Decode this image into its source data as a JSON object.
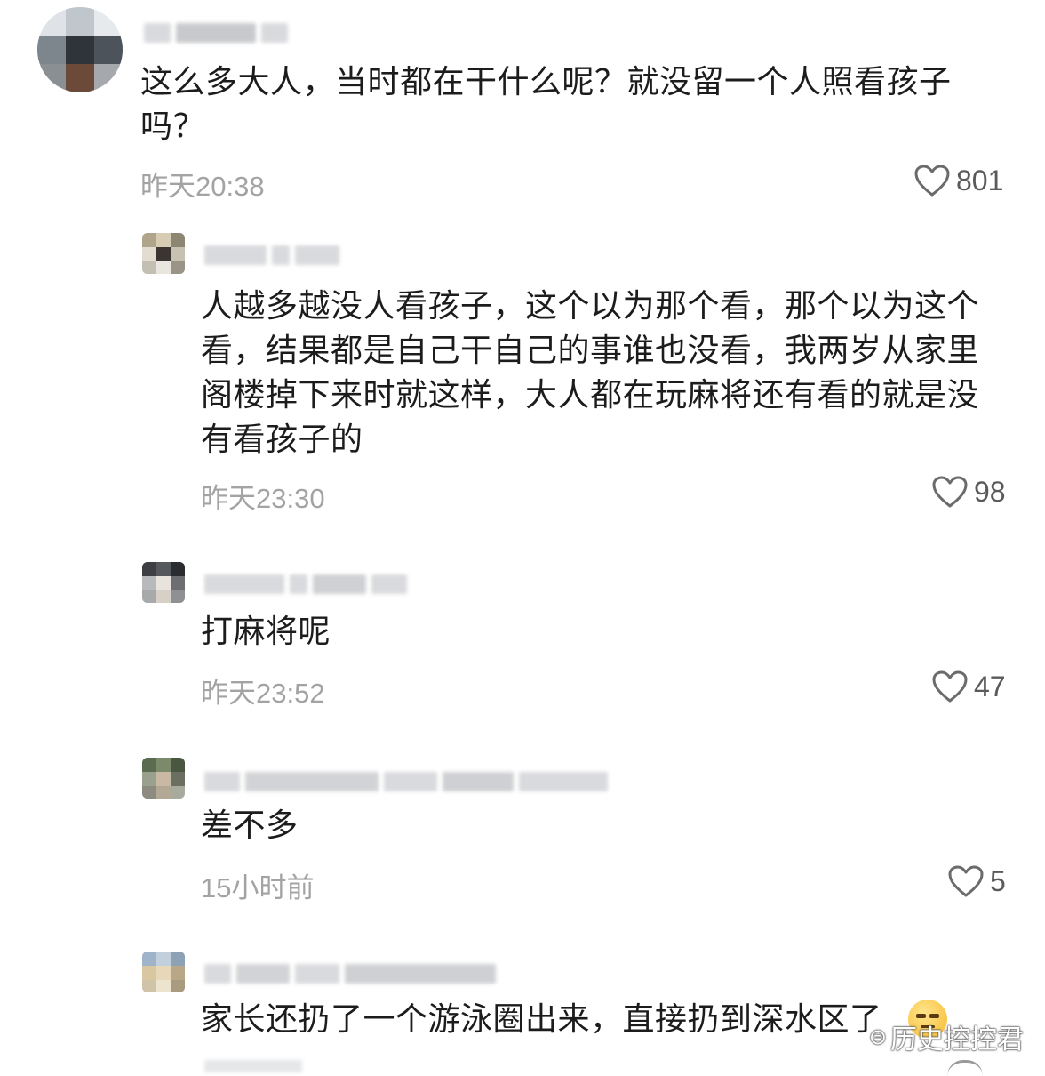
{
  "comments": [
    {
      "text": "这么多大人，当时都在干什么呢？就没留一个人照看孩子吗？",
      "time": "昨天20:38",
      "likes": "801"
    },
    {
      "text": "人越多越没人看孩子，这个以为那个看，那个以为这个看，结果都是自己干自己的事谁也没看，我两岁从家里阁楼掉下来时就这样，大人都在玩麻将还有看的就是没有看孩子的",
      "time": "昨天23:30",
      "likes": "98"
    },
    {
      "text": "打麻将呢",
      "time": "昨天23:52",
      "likes": "47"
    },
    {
      "text": "差不多",
      "time": "15小时前",
      "likes": "5"
    },
    {
      "text": "家长还扔了一个游泳圈出来，直接扔到深水区了",
      "time": "",
      "likes": ""
    }
  ],
  "watermark": {
    "text": "历史控控君",
    "logo": "头条"
  },
  "colors": {
    "text": "#1c1c1c",
    "meta": "#a3a3a3",
    "like_icon": "#6b6b6b"
  },
  "icons": {
    "like": "heart-outline-icon",
    "avatar": "pixelated-avatar"
  }
}
